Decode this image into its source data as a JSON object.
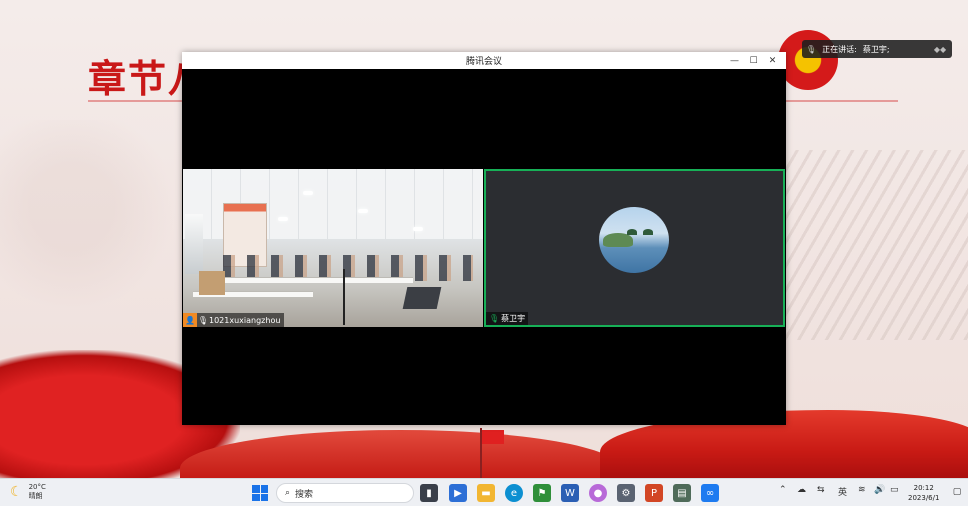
{
  "desktop": {
    "slide_title": "章节八"
  },
  "meeting_window": {
    "title": "腾讯会议",
    "controls": {
      "minimize": "—",
      "maximize": "☐",
      "close": "✕"
    },
    "participants": [
      {
        "name": "1021xuxiangzhou",
        "role": "host",
        "muted": false
      },
      {
        "name": "蔡卫宇",
        "speaking": true
      }
    ]
  },
  "speaking_banner": {
    "label": "正在讲话:",
    "name": "蔡卫宇;"
  },
  "taskbar": {
    "weather": {
      "temp": "20°C",
      "condition": "晴朗"
    },
    "search_placeholder": "搜索",
    "apps": [
      {
        "name": "task-view",
        "color": "#3a3f4a"
      },
      {
        "name": "media-player",
        "color": "#2d6fd6"
      },
      {
        "name": "file-explorer",
        "color": "#f2b632"
      },
      {
        "name": "edge",
        "color": "#0c8fd1"
      },
      {
        "name": "app-flag",
        "color": "#2f8f3a"
      },
      {
        "name": "word",
        "color": "#2b5fb4"
      },
      {
        "name": "app-colorful",
        "color": "#b86ad8"
      },
      {
        "name": "settings",
        "color": "#5a6372"
      },
      {
        "name": "powerpoint",
        "color": "#d24625"
      },
      {
        "name": "app-board",
        "color": "#4f6b5a"
      },
      {
        "name": "tencent-meeting",
        "color": "#1e7bf0"
      }
    ],
    "tray": {
      "ime": "英"
    },
    "clock": {
      "time": "20:12",
      "date": "2023/6/1"
    }
  },
  "colors": {
    "accent_red": "#c91818",
    "speaker_border": "#17b057",
    "host_badge": "#f08a24"
  }
}
